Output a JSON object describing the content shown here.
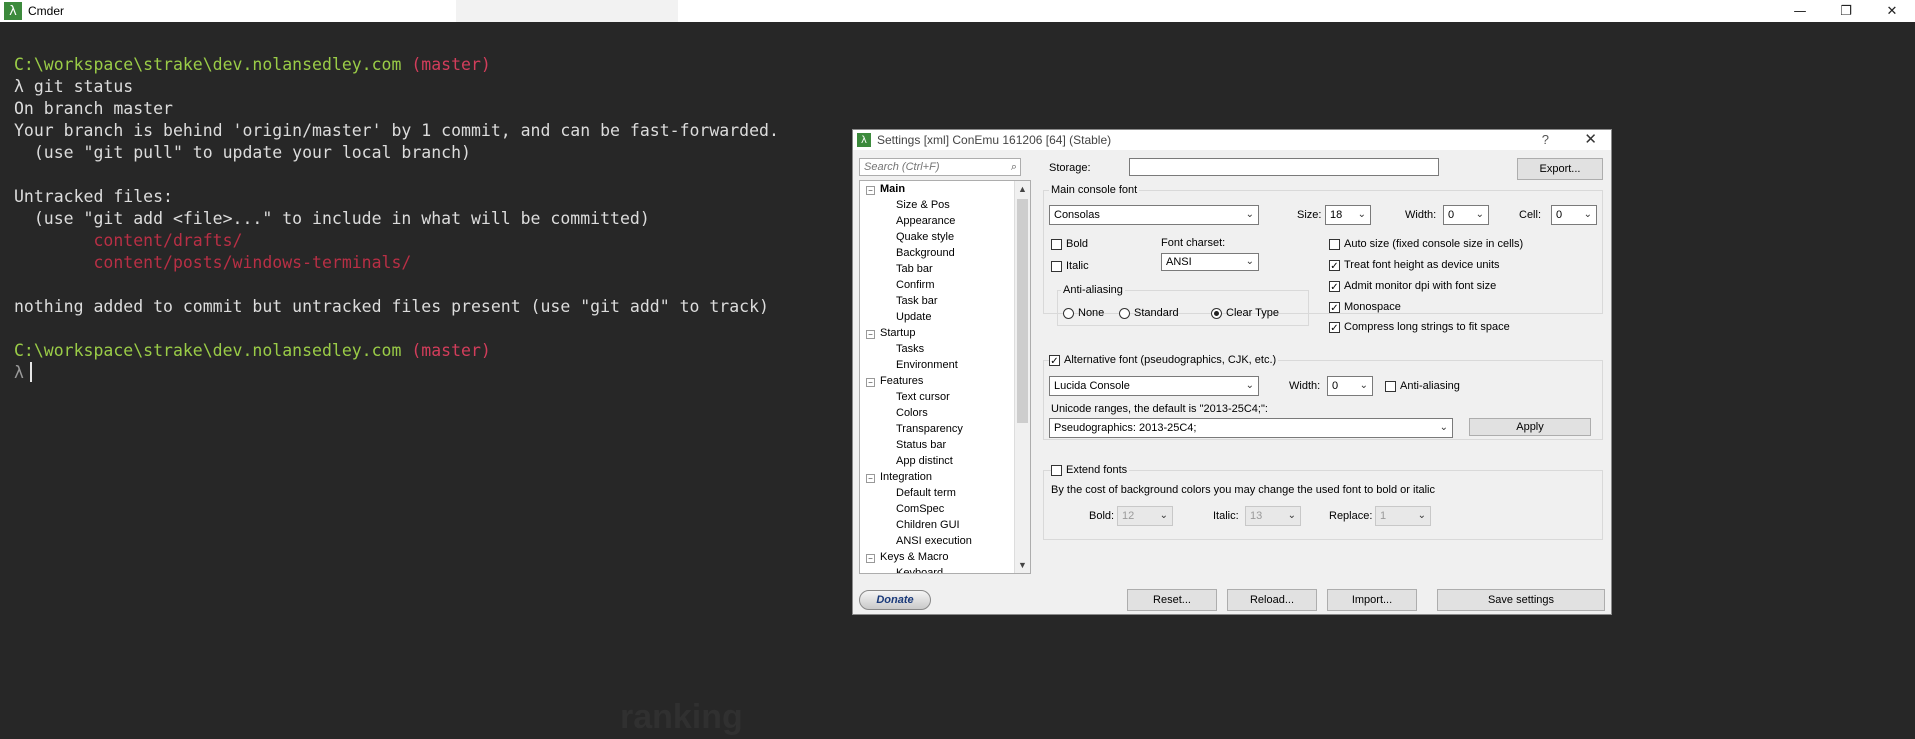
{
  "window": {
    "title": "Cmder",
    "controls": [
      "—",
      "❐",
      "✕"
    ]
  },
  "terminal": {
    "lines": [
      [
        {
          "t": "C:\\workspace\\strake\\dev.nolansedley.com ",
          "c": "green"
        },
        {
          "t": "(master)",
          "c": "pink"
        }
      ],
      [
        {
          "t": "λ git status",
          "c": ""
        }
      ],
      [
        {
          "t": "On branch master",
          "c": ""
        }
      ],
      [
        {
          "t": "Your branch is behind 'origin/master' by 1 commit, and can be fast-forwarded.",
          "c": ""
        }
      ],
      [
        {
          "t": "  (use \"git pull\" to update your local branch)",
          "c": ""
        }
      ],
      [
        {
          "t": "",
          "c": ""
        }
      ],
      [
        {
          "t": "Untracked files:",
          "c": ""
        }
      ],
      [
        {
          "t": "  (use \"git add <file>...\" to include in what will be committed)",
          "c": ""
        }
      ],
      [
        {
          "t": "        content/drafts/",
          "c": "red"
        }
      ],
      [
        {
          "t": "        content/posts/windows-terminals/",
          "c": "red"
        }
      ],
      [
        {
          "t": "",
          "c": ""
        }
      ],
      [
        {
          "t": "nothing added to commit but untracked files present (use \"git add\" to track)",
          "c": ""
        }
      ],
      [
        {
          "t": "",
          "c": ""
        }
      ],
      [
        {
          "t": "C:\\workspace\\strake\\dev.nolansedley.com ",
          "c": "green"
        },
        {
          "t": "(master)",
          "c": "pink"
        }
      ]
    ],
    "prompt": "λ",
    "background_ghost_text": "ranking"
  },
  "dialog": {
    "title": "Settings [xml] ConEmu 161206 [64] (Stable)",
    "help": "?",
    "close": "✕",
    "search_placeholder": "Search (Ctrl+F)",
    "tree": [
      {
        "label": "Main",
        "level": 0,
        "bold": true
      },
      {
        "label": "Size & Pos",
        "level": 1
      },
      {
        "label": "Appearance",
        "level": 1
      },
      {
        "label": "Quake style",
        "level": 1
      },
      {
        "label": "Background",
        "level": 1
      },
      {
        "label": "Tab bar",
        "level": 1
      },
      {
        "label": "Confirm",
        "level": 1
      },
      {
        "label": "Task bar",
        "level": 1
      },
      {
        "label": "Update",
        "level": 1
      },
      {
        "label": "Startup",
        "level": 0
      },
      {
        "label": "Tasks",
        "level": 1
      },
      {
        "label": "Environment",
        "level": 1
      },
      {
        "label": "Features",
        "level": 0
      },
      {
        "label": "Text cursor",
        "level": 1
      },
      {
        "label": "Colors",
        "level": 1
      },
      {
        "label": "Transparency",
        "level": 1
      },
      {
        "label": "Status bar",
        "level": 1
      },
      {
        "label": "App distinct",
        "level": 1
      },
      {
        "label": "Integration",
        "level": 0
      },
      {
        "label": "Default term",
        "level": 1
      },
      {
        "label": "ComSpec",
        "level": 1
      },
      {
        "label": "Children GUI",
        "level": 1
      },
      {
        "label": "ANSI execution",
        "level": 1
      },
      {
        "label": "Keys & Macro",
        "level": 0
      },
      {
        "label": "Keyboard",
        "level": 1
      }
    ],
    "storage_label": "Storage:",
    "storage_value": "",
    "export_label": "Export...",
    "main_font": {
      "group_label": "Main console font",
      "font": "Consolas",
      "size_label": "Size:",
      "size": "18",
      "width_label": "Width:",
      "width": "0",
      "cell_label": "Cell:",
      "cell": "0",
      "bold_label": "Bold",
      "bold": false,
      "italic_label": "Italic",
      "italic": false,
      "charset_label": "Font charset:",
      "charset": "ANSI",
      "auto_size_label": "Auto size (fixed console size in cells)",
      "auto_size": false,
      "treat_height_label": "Treat font height as device units",
      "treat_height": true,
      "admit_dpi_label": "Admit monitor dpi with font size",
      "admit_dpi": true,
      "monospace_label": "Monospace",
      "monospace": true,
      "compress_label": "Compress long strings to fit space",
      "compress": true,
      "anti_aliasing_label": "Anti-aliasing",
      "aa_none": "None",
      "aa_standard": "Standard",
      "aa_cleartype": "Clear Type",
      "aa_selected": "cleartype"
    },
    "alt_font": {
      "label": "Alternative font (pseudographics, CJK, etc.)",
      "enabled": true,
      "font": "Lucida Console",
      "width_label": "Width:",
      "width": "0",
      "anti_aliasing_label": "Anti-aliasing",
      "anti_aliasing": false,
      "unicode_label": "Unicode ranges, the default is \"2013-25C4;\":",
      "unicode_value": "Pseudographics: 2013-25C4;",
      "apply_label": "Apply"
    },
    "extend": {
      "label": "Extend fonts",
      "enabled": false,
      "description": "By the cost of background colors you may change the used font to bold or italic",
      "bold_label": "Bold:",
      "bold_value": "12",
      "italic_label": "Italic:",
      "italic_value": "13",
      "replace_label": "Replace:",
      "replace_value": "1"
    },
    "buttons": {
      "donate": "Donate",
      "reset": "Reset...",
      "reload": "Reload...",
      "import": "Import...",
      "save": "Save settings"
    }
  }
}
